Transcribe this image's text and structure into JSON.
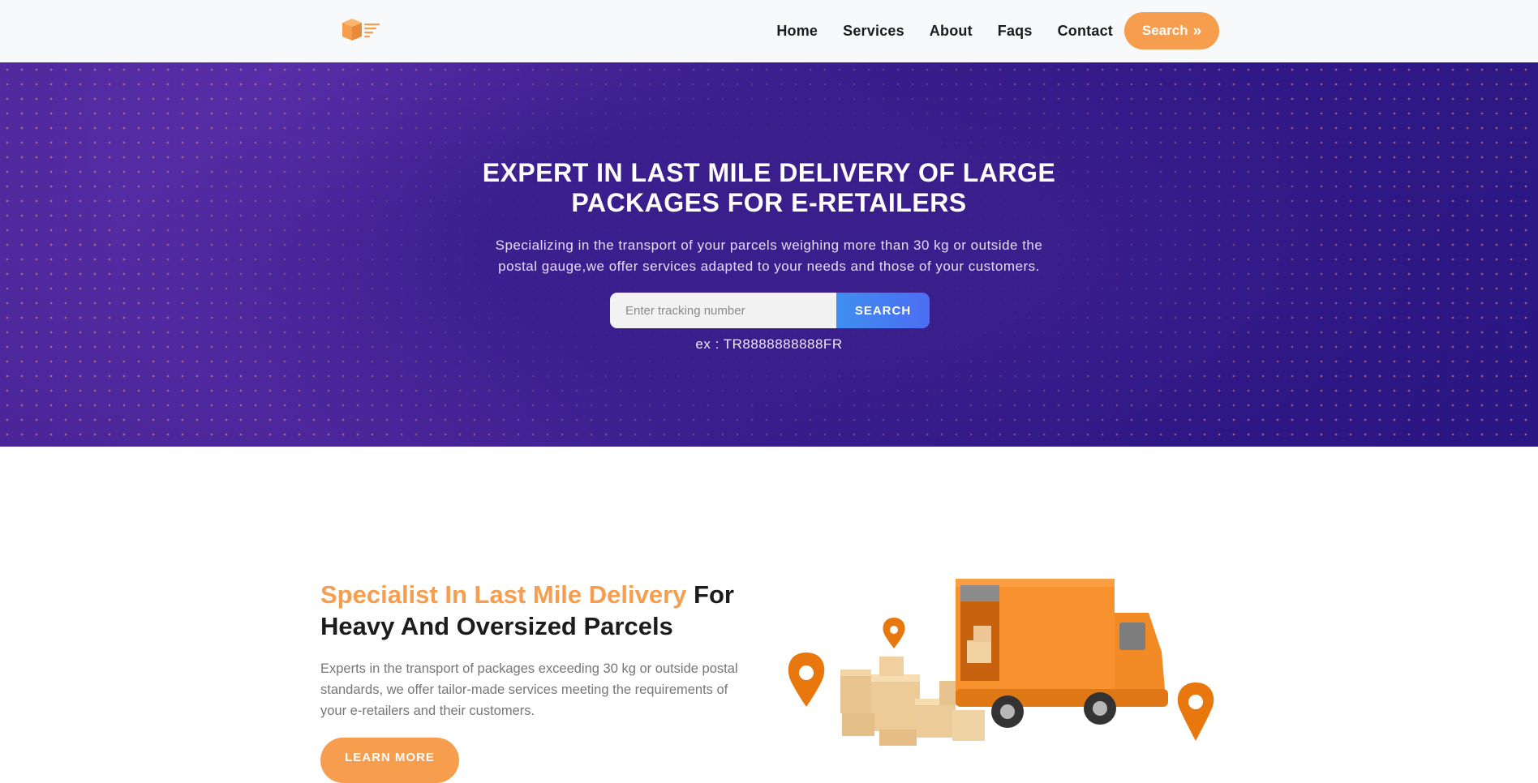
{
  "nav": {
    "logo_icon": "delivery-box-icon",
    "links": [
      "Home",
      "Services",
      "About",
      "Faqs",
      "Contact"
    ],
    "search_label": "Search",
    "search_icon": "double-chevron-right-icon",
    "accent_color": "#f79d4e"
  },
  "hero": {
    "title_line1": "EXPERT IN LAST MILE DELIVERY OF LARGE",
    "title_line2": "PACKAGES FOR E-RETAILERS",
    "subtitle_line1": "Specializing in the transport of your parcels weighing more than 30 kg or outside the",
    "subtitle_line2": "postal gauge,we offer services adapted to your needs and those of your customers.",
    "tracking_placeholder": "Enter tracking number",
    "tracking_button": "SEARCH",
    "example": "ex : TR8888888888FR",
    "background_color": "#3a1c8c"
  },
  "section": {
    "title_accent": "Specialist In Last Mile Delivery",
    "title_rest": " For Heavy And Oversized Parcels",
    "text": "Experts in the transport of packages exceeding 30 kg or outside postal standards, we offer tailor-made services meeting the requirements of your e-retailers and their customers.",
    "button_label": "LEARN MORE",
    "illustration": "delivery-truck-illustration"
  }
}
